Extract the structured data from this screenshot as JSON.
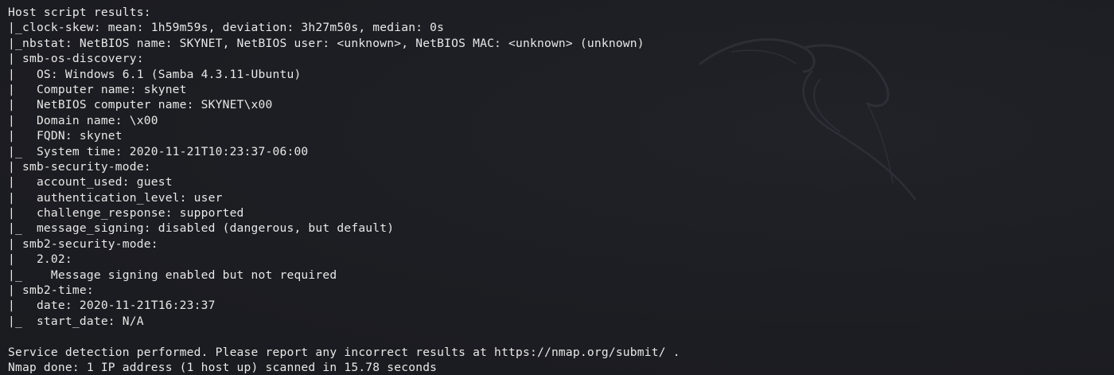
{
  "terminal": {
    "lines": [
      "Host script results:",
      "|_clock-skew: mean: 1h59m59s, deviation: 3h27m50s, median: 0s",
      "|_nbstat: NetBIOS name: SKYNET, NetBIOS user: <unknown>, NetBIOS MAC: <unknown> (unknown)",
      "| smb-os-discovery:",
      "|   OS: Windows 6.1 (Samba 4.3.11-Ubuntu)",
      "|   Computer name: skynet",
      "|   NetBIOS computer name: SKYNET\\x00",
      "|   Domain name: \\x00",
      "|   FQDN: skynet",
      "|_  System time: 2020-11-21T10:23:37-06:00",
      "| smb-security-mode:",
      "|   account_used: guest",
      "|   authentication_level: user",
      "|   challenge_response: supported",
      "|_  message_signing: disabled (dangerous, but default)",
      "| smb2-security-mode:",
      "|   2.02:",
      "|_    Message signing enabled but not required",
      "| smb2-time:",
      "|   date: 2020-11-21T16:23:37",
      "|_  start_date: N/A",
      "",
      "Service detection performed. Please report any incorrect results at https://nmap.org/submit/ .",
      "Nmap done: 1 IP address (1 host up) scanned in 15.78 seconds"
    ]
  },
  "colors": {
    "background": "#1c1d22",
    "text": "#e8e8e8",
    "watermark": "#3a3d45"
  },
  "icons": {
    "watermark": "kali-dragon-icon"
  }
}
